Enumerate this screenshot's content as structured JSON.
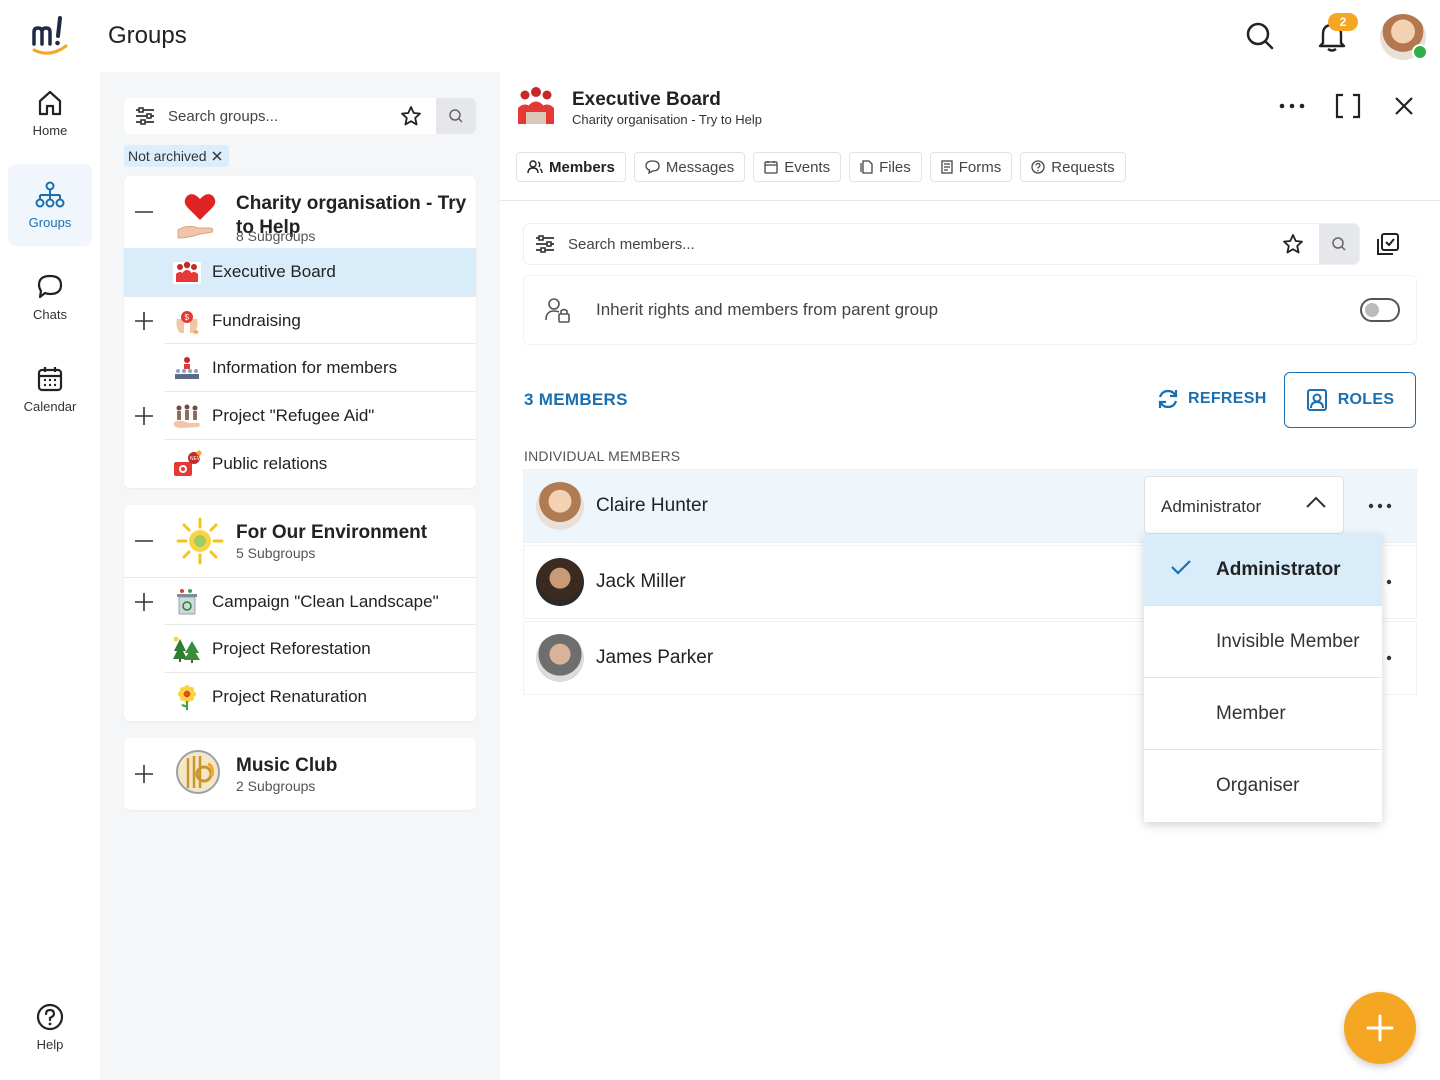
{
  "app": {
    "title": "Groups",
    "notification_count": "2"
  },
  "icons": {
    "logo": "mitgliederverwaltung-logo",
    "search": "search-icon",
    "bell": "bell-icon",
    "filter": "filter-sliders-icon",
    "star": "star-icon",
    "close": "close-icon"
  },
  "nav": {
    "home": "Home",
    "groups": "Groups",
    "chats": "Chats",
    "calendar": "Calendar",
    "help": "Help"
  },
  "groups_panel": {
    "search_placeholder": "Search groups...",
    "filter_chip": "Not archived",
    "groups": [
      {
        "name": "Charity organisation - Try to Help",
        "subgroup_count": "8 Subgroups",
        "subgroups": [
          {
            "name": "Executive Board"
          },
          {
            "name": "Fundraising"
          },
          {
            "name": "Information for members"
          },
          {
            "name": "Project \"Refugee Aid\""
          },
          {
            "name": "Public relations"
          }
        ]
      },
      {
        "name": "For Our Environment",
        "subgroup_count": "5 Subgroups",
        "subgroups": [
          {
            "name": "Campaign \"Clean Landscape\""
          },
          {
            "name": "Project Reforestation"
          },
          {
            "name": "Project Renaturation"
          }
        ]
      },
      {
        "name": "Music Club",
        "subgroup_count": "2 Subgroups"
      }
    ]
  },
  "detail": {
    "title": "Executive Board",
    "subtitle": "Charity organisation - Try to Help",
    "tabs": [
      "Members",
      "Messages",
      "Events",
      "Files",
      "Forms",
      "Requests"
    ],
    "member_search_placeholder": "Search members...",
    "inherit_label": "Inherit rights and members from parent group",
    "inherit_enabled": false,
    "members_count": "3 MEMBERS",
    "refresh_label": "REFRESH",
    "roles_label": "ROLES",
    "individual_label": "INDIVIDUAL MEMBERS",
    "members": [
      {
        "name": "Claire Hunter",
        "role": "Administrator"
      },
      {
        "name": "Jack Miller"
      },
      {
        "name": "James Parker"
      }
    ],
    "role_options": [
      "Administrator",
      "Invisible Member",
      "Member",
      "Organiser"
    ],
    "selected_role": "Administrator"
  },
  "colors": {
    "accent": "#1a6fb0",
    "fab": "#f5a623",
    "selected_bg": "#d9ecfa"
  }
}
